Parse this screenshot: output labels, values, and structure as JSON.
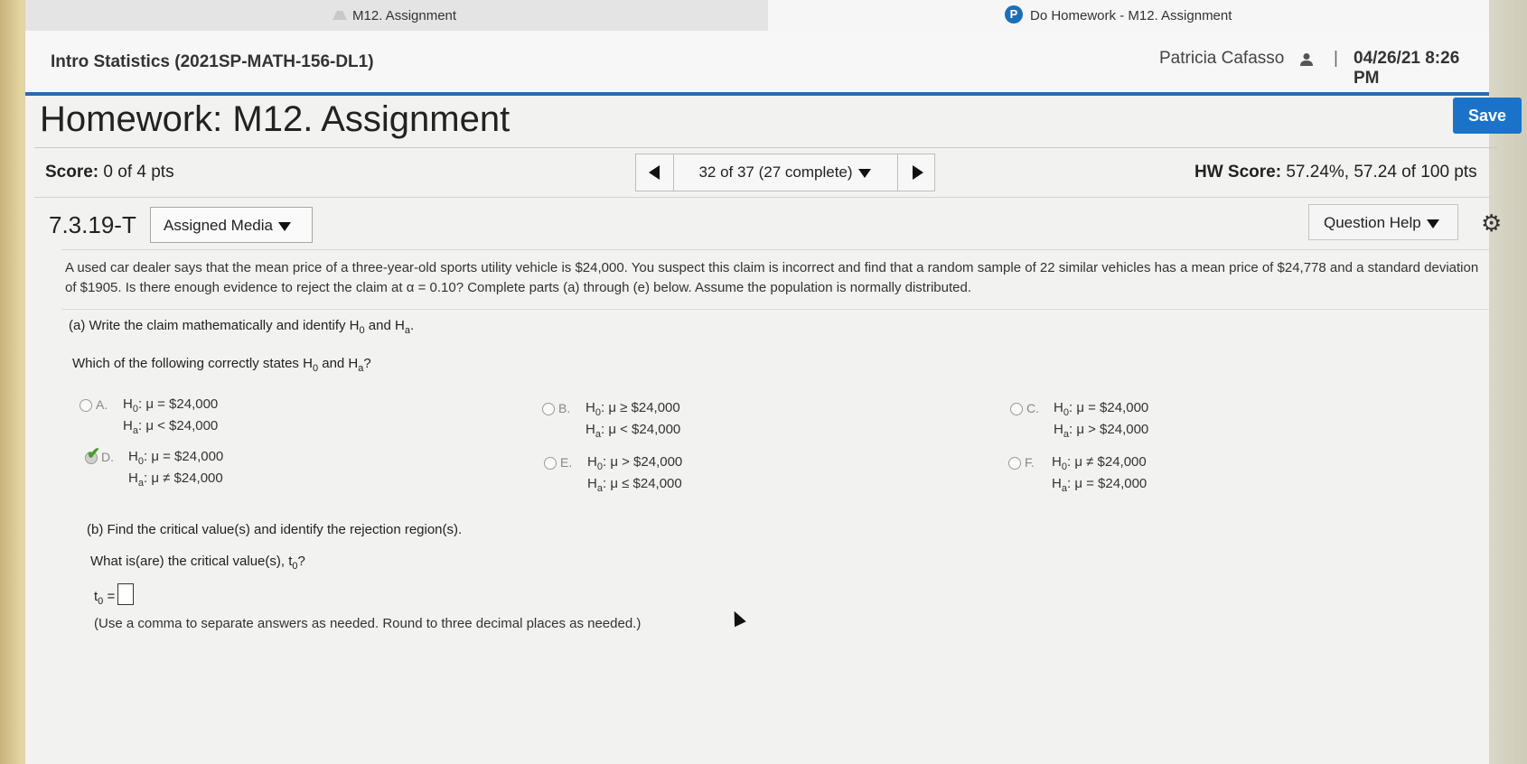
{
  "browser": {
    "tab1_title": "M12. Assignment",
    "tab2_title": "Do Homework - M12. Assignment"
  },
  "header": {
    "course": "Intro Statistics (2021SP-MATH-156-DL1)",
    "user": "Patricia Cafasso",
    "separator": "|",
    "datetime": "04/26/21 8:26 PM"
  },
  "homework": {
    "title": "Homework: M12. Assignment",
    "save_label": "Save",
    "score_label": "Score:",
    "score_value": "0 of 4 pts",
    "nav_position": "32 of 37 (27 complete)",
    "hw_score_label": "HW Score:",
    "hw_score_value": "57.24%, 57.24 of 100 pts",
    "question_id": "7.3.19-T",
    "assigned_media_label": "Assigned Media",
    "question_help_label": "Question Help"
  },
  "question": {
    "problem_text": "A used car dealer says that the mean price of a three-year-old sports utility vehicle is $24,000. You suspect this claim is incorrect and find that a random sample of 22 similar vehicles has a mean price of $24,778 and a standard deviation of $1905. Is there enough evidence to reject the claim at α = 0.10? Complete parts (a) through (e) below. Assume the population is normally distributed.",
    "part_a": "(a) Write the claim mathematically and identify",
    "which": "Which of the following correctly states",
    "options": [
      {
        "letter": "A.",
        "h0": "μ = $24,000",
        "ha": "μ < $24,000"
      },
      {
        "letter": "B.",
        "h0": "μ ≥ $24,000",
        "ha": "μ < $24,000"
      },
      {
        "letter": "C.",
        "h0": "μ = $24,000",
        "ha": "μ > $24,000"
      },
      {
        "letter": "D.",
        "h0": "μ = $24,000",
        "ha": "μ ≠ $24,000"
      },
      {
        "letter": "E.",
        "h0": "μ > $24,000",
        "ha": "μ ≤ $24,000"
      },
      {
        "letter": "F.",
        "h0": "μ ≠ $24,000",
        "ha": "μ = $24,000"
      }
    ],
    "selected_option": "D.",
    "part_b": "(b) Find the critical value(s) and identify the rejection region(s).",
    "critical_question": "What is(are) the critical value(s), t",
    "t0_label": "t",
    "t0_value": "",
    "hint": "(Use a comma to separate answers as needed. Round to three decimal places as needed.)"
  },
  "colors": {
    "accent": "#2d6aa8",
    "save": "#1a73c8",
    "check": "#4a9a2a"
  }
}
